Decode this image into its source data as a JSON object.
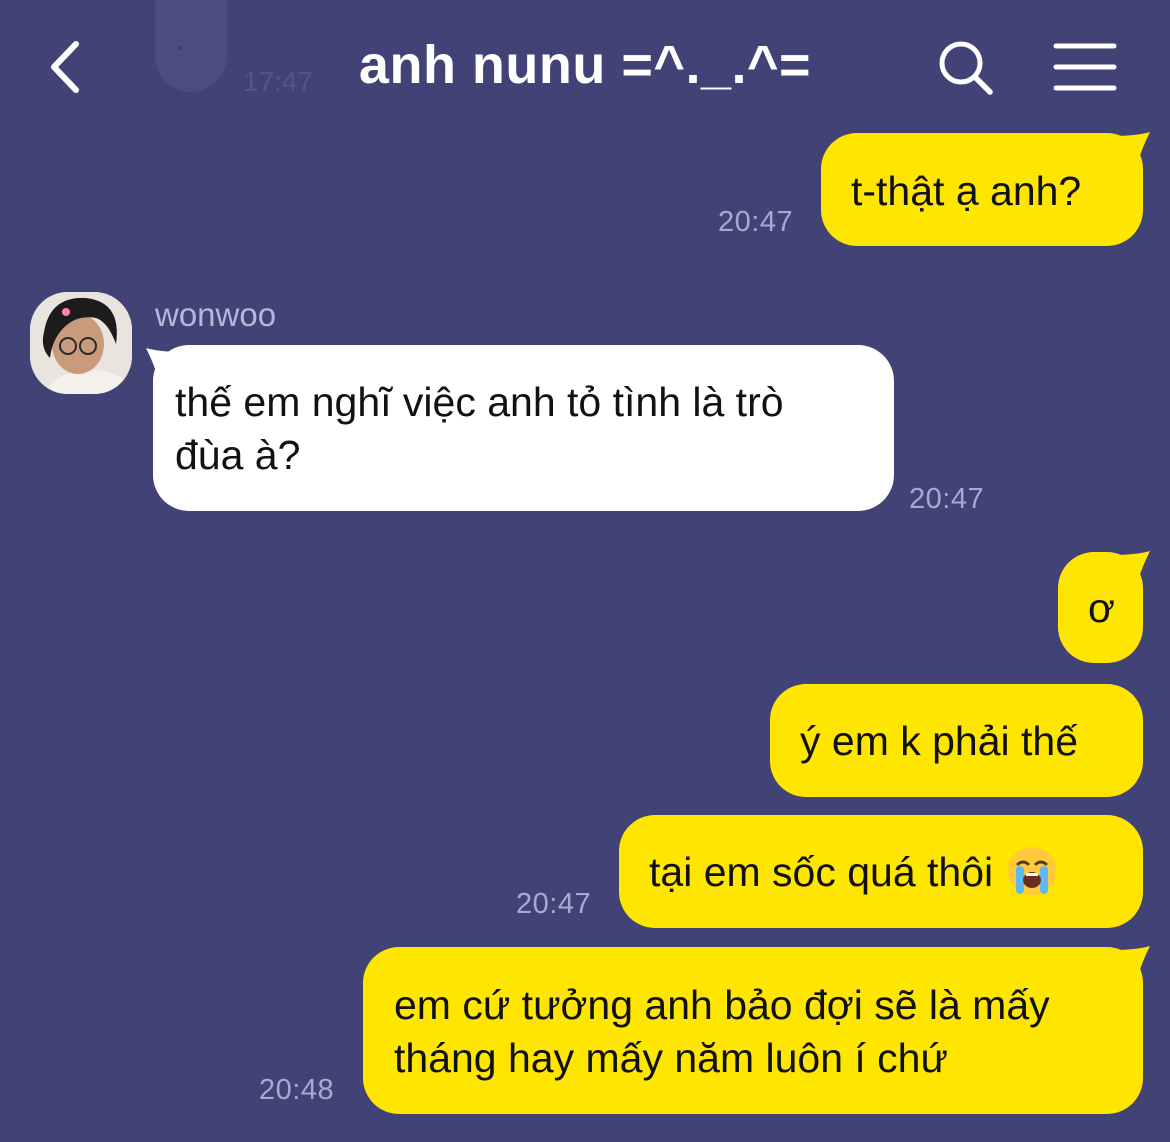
{
  "header": {
    "title": "anh nunu =^._.^=",
    "ghost_time": "17:47"
  },
  "conversation": {
    "sender_name": "wonwoo",
    "messages": [
      {
        "direction": "out",
        "text": "t-thật ạ anh?",
        "time": "20:47"
      },
      {
        "direction": "in",
        "line1": "thế em nghĩ việc anh tỏ tình là trò",
        "line2": "đùa à?",
        "time": "20:47"
      },
      {
        "direction": "out",
        "text": "ơ"
      },
      {
        "direction": "out",
        "text": "ý em k phải thế"
      },
      {
        "direction": "out",
        "text": "tại em sốc quá thôi",
        "emoji": "loudly-crying-face-icon",
        "time": "20:47"
      },
      {
        "direction": "out",
        "line1": "em cứ tưởng anh bảo đợi sẽ là mấy",
        "line2": "tháng hay mấy năm luôn í chứ",
        "time": "20:48"
      }
    ]
  },
  "colors": {
    "background": "#414275",
    "outgoing_bubble": "#ffe600",
    "incoming_bubble": "#ffffff",
    "timestamp": "#a7a9d1"
  },
  "icons": {
    "back": "back-chevron-icon",
    "search": "search-icon",
    "menu": "hamburger-menu-icon"
  }
}
